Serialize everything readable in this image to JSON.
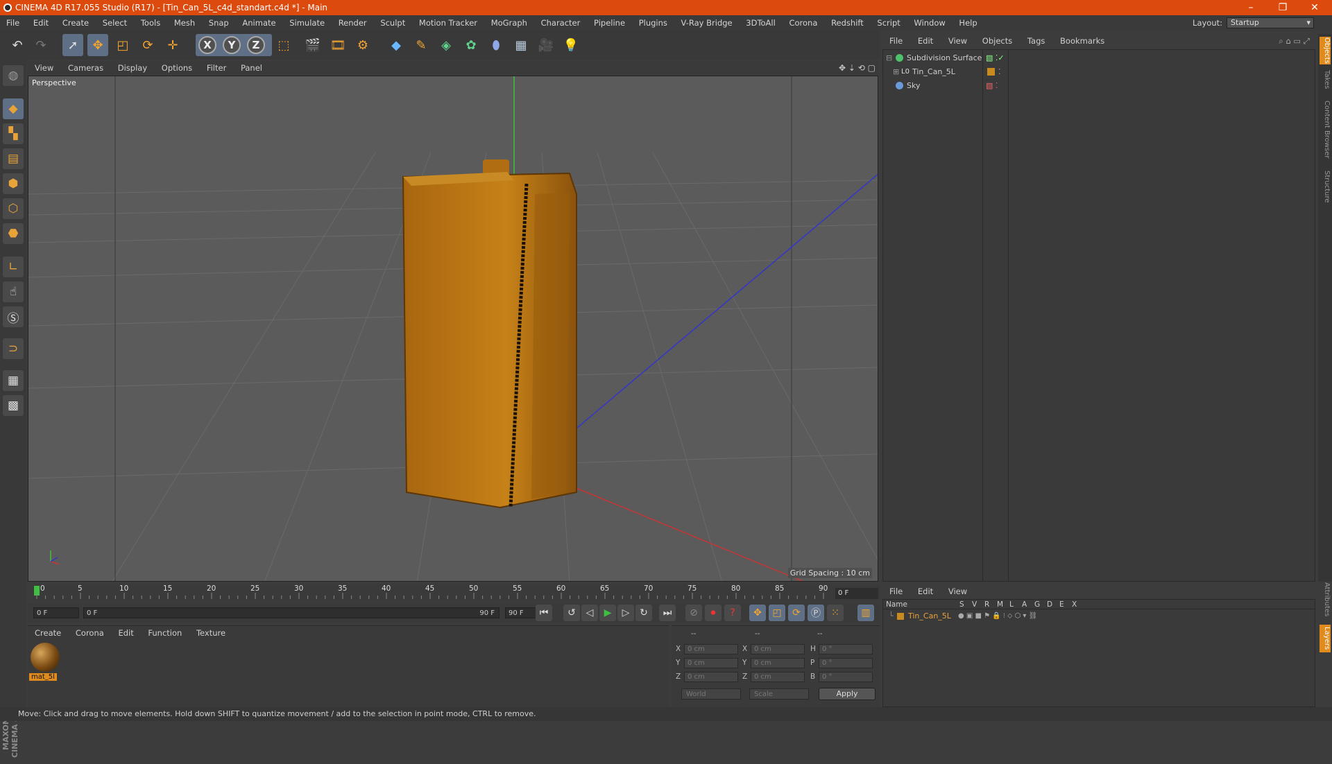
{
  "window": {
    "title": "CINEMA 4D R17.055 Studio (R17) - [Tin_Can_5L_c4d_standart.c4d *] - Main",
    "minimize": "–",
    "maximize": "❐",
    "close": "✕"
  },
  "menubar": {
    "items": [
      "File",
      "Edit",
      "Create",
      "Select",
      "Tools",
      "Mesh",
      "Snap",
      "Animate",
      "Simulate",
      "Render",
      "Sculpt",
      "Motion Tracker",
      "MoGraph",
      "Character",
      "Pipeline",
      "Plugins",
      "V-Ray Bridge",
      "3DToAll",
      "Corona",
      "Redshift",
      "Script",
      "Window",
      "Help"
    ],
    "layout_label": "Layout:",
    "layout_value": "Startup"
  },
  "toolbar": {
    "axis_x": "X",
    "axis_y": "Y",
    "axis_z": "Z"
  },
  "viewport": {
    "menu": [
      "View",
      "Cameras",
      "Display",
      "Options",
      "Filter",
      "Panel"
    ],
    "label": "Perspective",
    "grid_spacing": "Grid Spacing : 10 cm"
  },
  "object_manager": {
    "menu": [
      "File",
      "Edit",
      "View",
      "Objects",
      "Tags",
      "Bookmarks"
    ],
    "objects": [
      {
        "name": "Subdivision Surface",
        "color": "#4ec26a"
      },
      {
        "name": "Tin_Can_5L",
        "color": "#c9c9c9"
      },
      {
        "name": "Sky",
        "color": "#6a9ad8"
      }
    ]
  },
  "side_tabs": [
    "Objects",
    "Takes",
    "Content Browser",
    "Structure",
    "Attributes",
    "Layers"
  ],
  "timeline": {
    "ticks": [
      "0",
      "5",
      "10",
      "15",
      "20",
      "25",
      "30",
      "35",
      "40",
      "45",
      "50",
      "55",
      "60",
      "65",
      "70",
      "75",
      "80",
      "85",
      "90"
    ],
    "current_frame": "0 F",
    "start_field": "0 F",
    "range_start": "0 F",
    "range_end": "90 F",
    "end_field": "90 F"
  },
  "material_manager": {
    "menu": [
      "Create",
      "Corona",
      "Edit",
      "Function",
      "Texture"
    ],
    "materials": [
      {
        "name": "mat_5l"
      }
    ]
  },
  "coordinates": {
    "headers": [
      "--",
      "--",
      "--"
    ],
    "rows": [
      {
        "a": "X",
        "av": "0 cm",
        "b": "X",
        "bv": "0 cm",
        "c": "H",
        "cv": "0 °"
      },
      {
        "a": "Y",
        "av": "0 cm",
        "b": "Y",
        "bv": "0 cm",
        "c": "P",
        "cv": "0 °"
      },
      {
        "a": "Z",
        "av": "0 cm",
        "b": "Z",
        "bv": "0 cm",
        "c": "B",
        "cv": "0 °"
      }
    ],
    "space": "World",
    "mode": "Scale",
    "apply": "Apply"
  },
  "layers": {
    "menu": [
      "File",
      "Edit",
      "View"
    ],
    "columns": [
      "Name",
      "S",
      "V",
      "R",
      "M",
      "L",
      "A",
      "G",
      "D",
      "E",
      "X"
    ],
    "rows": [
      {
        "name": "Tin_Can_5L"
      }
    ]
  },
  "statusbar": {
    "text": "Move: Click and drag to move elements. Hold down SHIFT to quantize movement / add to the selection in point mode, CTRL to remove."
  },
  "branding": "MAXON CINEMA 4D",
  "colors": {
    "accent": "#dd4a0e",
    "selection": "#e08b1e",
    "object_orange": "#c98a1e"
  }
}
